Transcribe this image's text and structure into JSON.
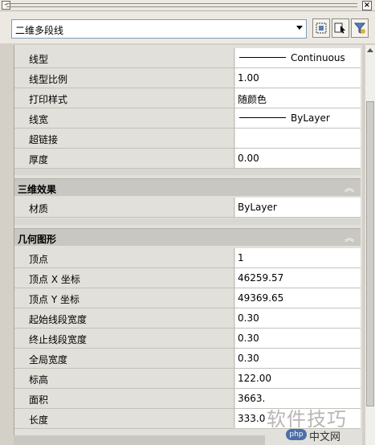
{
  "palette": {
    "key_bg": "#e2e0da",
    "value_bg": "#ffffff",
    "section_bg": "#c9c7c1"
  },
  "title_strip": {
    "close_icon": "close-icon"
  },
  "object_selector": {
    "value": "二维多段线"
  },
  "toolbar": {
    "quick_select_icon": "quick-select-icon",
    "select_objects_icon": "select-objects-icon",
    "pickadd_icon": "pickadd-toggle-icon"
  },
  "general_rows": [
    {
      "key": "线型",
      "value": "Continuous",
      "line_sample": true
    },
    {
      "key": "线型比例",
      "value": "1.00"
    },
    {
      "key": "打印样式",
      "value": "随颜色"
    },
    {
      "key": "线宽",
      "value": "ByLayer",
      "line_sample": true
    },
    {
      "key": "超链接",
      "value": ""
    },
    {
      "key": "厚度",
      "value": "0.00"
    }
  ],
  "section_3d": {
    "title": "三维效果",
    "rows": [
      {
        "key": "材质",
        "value": "ByLayer"
      }
    ]
  },
  "section_geometry": {
    "title": "几何图形",
    "rows": [
      {
        "key": "顶点",
        "value": "1"
      },
      {
        "key": "顶点 X 坐标",
        "value": "46259.57"
      },
      {
        "key": "顶点 Y 坐标",
        "value": "49369.65"
      },
      {
        "key": "起始线段宽度",
        "value": "0.30"
      },
      {
        "key": "终止线段宽度",
        "value": "0.30"
      },
      {
        "key": "全局宽度",
        "value": "0.30"
      },
      {
        "key": "标高",
        "value": "122.00"
      },
      {
        "key": "面积",
        "value": "3663."
      },
      {
        "key": "长度",
        "value": "333.0"
      }
    ]
  },
  "watermark": {
    "big": "软件技巧",
    "badge": "php",
    "small": "中文网"
  }
}
